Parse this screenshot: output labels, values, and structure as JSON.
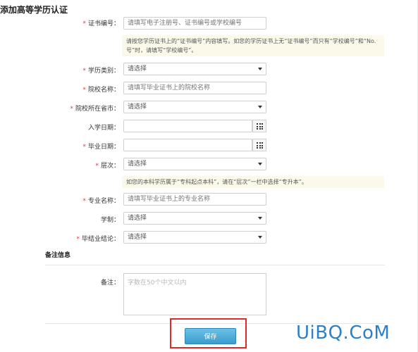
{
  "page": {
    "title": "添加高等学历认证"
  },
  "form": {
    "certificate_number": {
      "label": "证书编号：",
      "placeholder": "请填写电子注册号、证书编号或学校编号",
      "hint": "请按您学历证书上的“证书编号”内容填写。如您的学历证书上无“证书编号”而只有“学校编号”和“No.号”时，请填写“学校编号”。"
    },
    "education_type": {
      "label": "学历类别：",
      "value": "请选择"
    },
    "school_name": {
      "label": "院校名称：",
      "placeholder": "请填写毕业证书上的院校名称"
    },
    "school_province": {
      "label": "院校所在省市：",
      "value": "请选择"
    },
    "enroll_date": {
      "label": "入学日期：",
      "value": ""
    },
    "graduation_date": {
      "label": "毕业日期：",
      "value": ""
    },
    "level": {
      "label": "层次：",
      "value": "请选择",
      "hint": "如您的本科学历属于“专科起点本科”，请在“层次”一栏中选择“专升本”。"
    },
    "major": {
      "label": "专业名称：",
      "placeholder": "请填写毕业证书上的专业名称"
    },
    "duration": {
      "label": "学制：",
      "value": "请选择"
    },
    "conclusion": {
      "label": "毕结业结论：",
      "value": "请选择"
    }
  },
  "notes": {
    "section_title": "备注信息",
    "label": "备注：",
    "placeholder": "字数在50个中文以内"
  },
  "actions": {
    "save_label": "保存"
  },
  "watermark": {
    "text": "UiBQ.CoM"
  },
  "colors": {
    "required": "#e4393c",
    "hint_bg": "#fbfaea",
    "button": "#3a9ccd",
    "highlight": "#e22828",
    "watermark": "#2d7fc6"
  }
}
